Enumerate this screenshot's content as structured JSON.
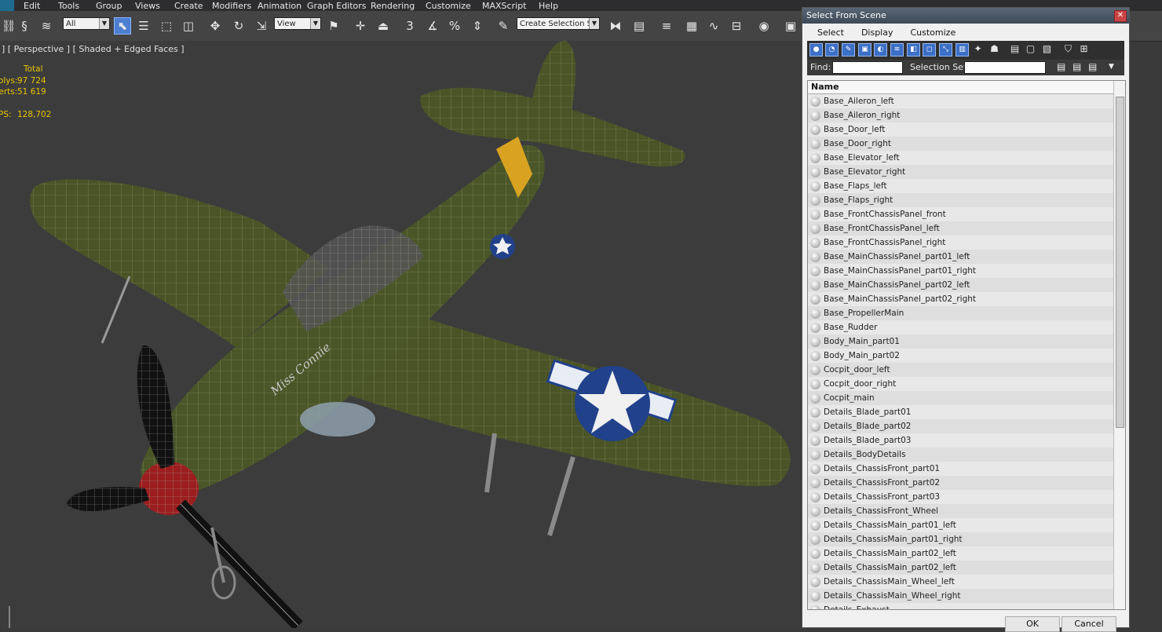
{
  "menubar": {
    "items": [
      "Edit",
      "Tools",
      "Group",
      "Views",
      "Create",
      "Modifiers",
      "Animation",
      "Graph Editors",
      "Rendering",
      "Customize",
      "MAXScript",
      "Help"
    ]
  },
  "toolbar": {
    "selection_filter": "All",
    "ref_coord": "View",
    "named_selection": "Create Selection Se"
  },
  "viewport": {
    "label": "] [ Perspective ] [ Shaded + Edged Faces ]",
    "stats": {
      "header": "Total",
      "polys_label": "Polys:",
      "polys": "97 724",
      "verts_label": "Verts:",
      "verts": "51 619",
      "fps_label": "FPS:",
      "fps": "128,702"
    },
    "nose_text": "Miss Connie"
  },
  "dialog": {
    "title": "Select From Scene",
    "menu": [
      "Select",
      "Display",
      "Customize"
    ],
    "find_label": "Find:",
    "selection_set_label": "Selection Set:",
    "column_name": "Name",
    "objects": [
      "Base_Aileron_left",
      "Base_Aileron_right",
      "Base_Door_left",
      "Base_Door_right",
      "Base_Elevator_left",
      "Base_Elevator_right",
      "Base_Flaps_left",
      "Base_Flaps_right",
      "Base_FrontChassisPanel_front",
      "Base_FrontChassisPanel_left",
      "Base_FrontChassisPanel_right",
      "Base_MainChassisPanel_part01_left",
      "Base_MainChassisPanel_part01_right",
      "Base_MainChassisPanel_part02_left",
      "Base_MainChassisPanel_part02_right",
      "Base_PropellerMain",
      "Base_Rudder",
      "Body_Main_part01",
      "Body_Main_part02",
      "Cocpit_door_left",
      "Cocpit_door_right",
      "Cocpit_main",
      "Details_Blade_part01",
      "Details_Blade_part02",
      "Details_Blade_part03",
      "Details_BodyDetails",
      "Details_ChassisFront_part01",
      "Details_ChassisFront_part02",
      "Details_ChassisFront_part03",
      "Details_ChassisFront_Wheel",
      "Details_ChassisMain_part01_left",
      "Details_ChassisMain_part01_right",
      "Details_ChassisMain_part02_left",
      "Details_ChassisMain_part02_left",
      "Details_ChassisMain_Wheel_left",
      "Details_ChassisMain_Wheel_right",
      "Details_Exhaust"
    ],
    "ok": "OK",
    "cancel": "Cancel"
  },
  "colors": {
    "accent": "#4c7fd1",
    "stats": "#e8c500",
    "plane_olive": "#4a5427"
  }
}
